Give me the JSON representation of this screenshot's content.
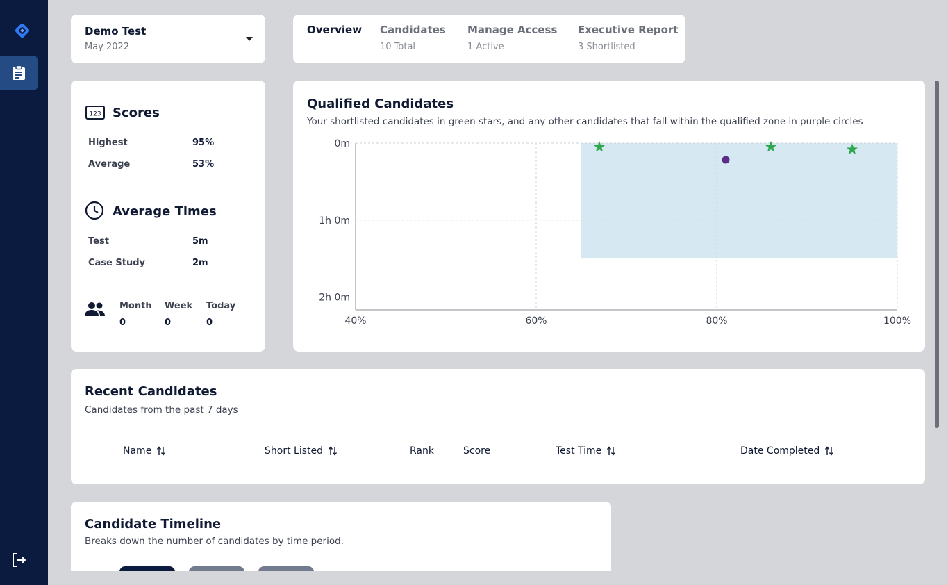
{
  "sidebar": {
    "logo_icon": "diamond-logo",
    "active_icon": "clipboard-icon",
    "logout_icon": "logout-icon"
  },
  "test_selector": {
    "name": "Demo Test",
    "date": "May 2022"
  },
  "tabs": [
    {
      "label": "Overview",
      "sub": ""
    },
    {
      "label": "Candidates",
      "sub": "10 Total"
    },
    {
      "label": "Manage Access",
      "sub": "1 Active"
    },
    {
      "label": "Executive Report",
      "sub": "3 Shortlisted"
    }
  ],
  "scores": {
    "title": "Scores",
    "highest_label": "Highest",
    "highest_value": "95%",
    "average_label": "Average",
    "average_value": "53%"
  },
  "average_times": {
    "title": "Average Times",
    "test_label": "Test",
    "test_value": "5m",
    "case_label": "Case Study",
    "case_value": "2m"
  },
  "activity": {
    "month_label": "Month",
    "month_value": "0",
    "week_label": "Week",
    "week_value": "0",
    "today_label": "Today",
    "today_value": "0"
  },
  "qualified": {
    "title": "Qualified Candidates",
    "subtitle": "Your shortlisted candidates in green stars, and any other candidates that fall within the qualified zone in purple circles"
  },
  "chart_data": {
    "type": "scatter",
    "title": "Qualified Candidates",
    "x_ticks": [
      "40%",
      "60%",
      "80%",
      "100%"
    ],
    "y_ticks": [
      "0m",
      "1h 0m",
      "2h 0m"
    ],
    "xlim": [
      40,
      100
    ],
    "ylim_minutes": [
      0,
      130
    ],
    "y_inverted": true,
    "grid": true,
    "qualified_zone": {
      "x": [
        65,
        100
      ],
      "y_minutes": [
        0,
        90
      ],
      "color": "#d6e8f1"
    },
    "series": [
      {
        "name": "shortlisted",
        "marker": "star",
        "color": "#2fa84f",
        "points": [
          [
            67,
            3
          ],
          [
            86,
            3
          ],
          [
            95,
            5
          ]
        ]
      },
      {
        "name": "qualified",
        "marker": "circle",
        "color": "#5b2d86",
        "points": [
          [
            81,
            13
          ]
        ]
      }
    ]
  },
  "recent": {
    "title": "Recent Candidates",
    "subtitle": "Candidates from the past 7 days",
    "columns": [
      "Name",
      "Short Listed",
      "Rank",
      "Score",
      "Test Time",
      "Date Completed"
    ]
  },
  "timeline": {
    "title": "Candidate Timeline",
    "subtitle": "Breaks down the number of candidates by time period."
  },
  "colors": {
    "navy": "#0b1a3f",
    "accent": "#254b84",
    "brand_blue": "#2f7bf5"
  }
}
